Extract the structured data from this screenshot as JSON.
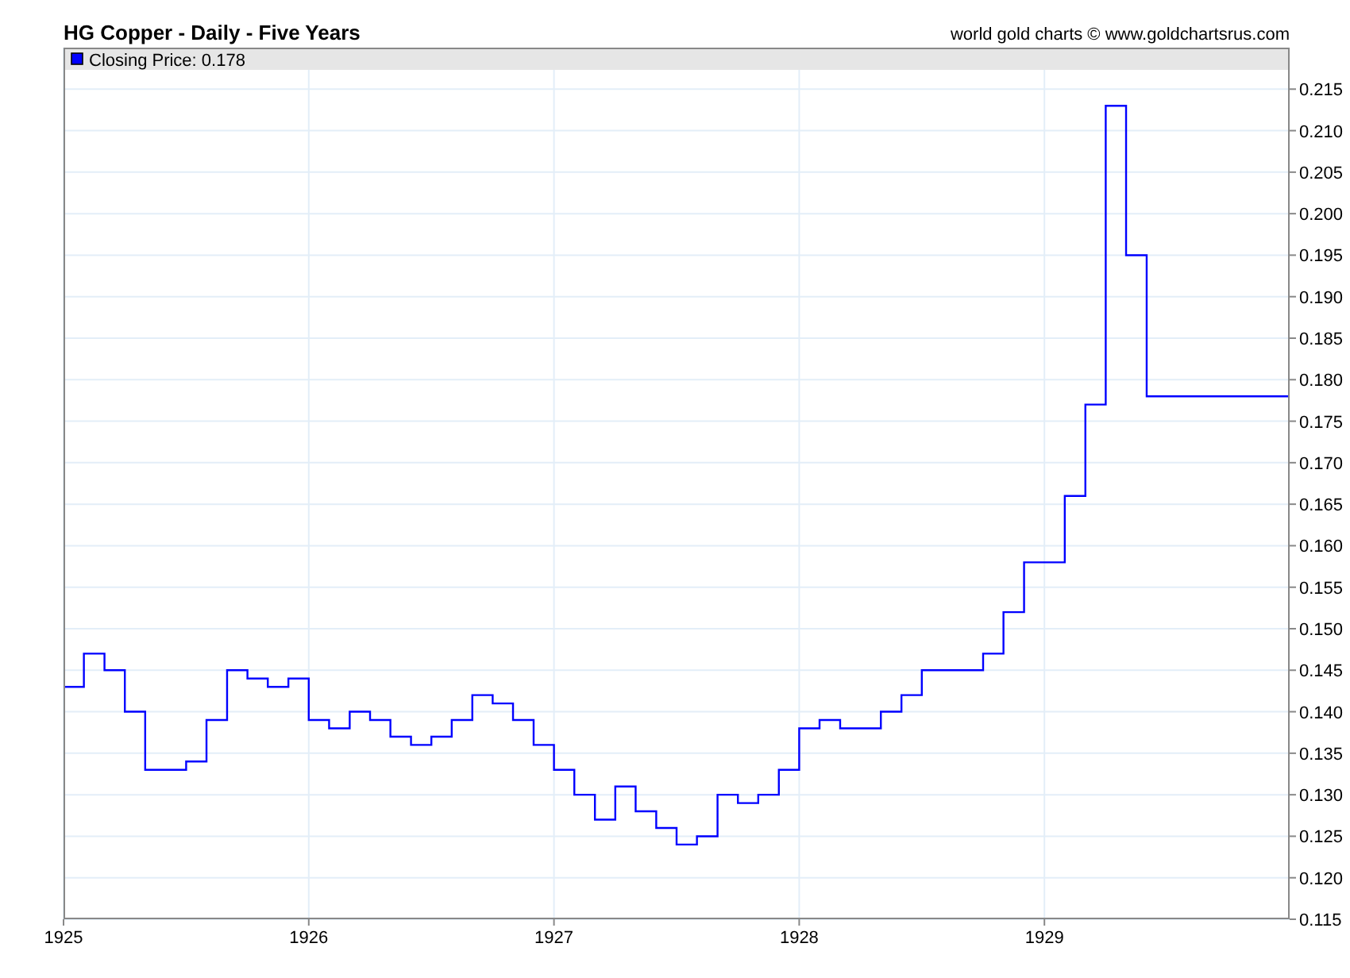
{
  "header": {
    "title": "HG Copper - Daily - Five Years",
    "credit": "world gold charts © www.goldchartsrus.com"
  },
  "chart_data": {
    "type": "line",
    "grid": true,
    "x": [
      1925,
      1925.083,
      1925.083,
      1925.167,
      1925.167,
      1925.25,
      1925.25,
      1925.333,
      1925.333,
      1925.5,
      1925.5,
      1925.583,
      1925.583,
      1925.667,
      1925.667,
      1925.75,
      1925.75,
      1925.833,
      1925.833,
      1925.917,
      1925.917,
      1926,
      1926,
      1926.083,
      1926.083,
      1926.167,
      1926.167,
      1926.25,
      1926.25,
      1926.333,
      1926.333,
      1926.417,
      1926.417,
      1926.5,
      1926.5,
      1926.583,
      1926.583,
      1926.667,
      1926.667,
      1926.75,
      1926.75,
      1926.833,
      1926.833,
      1926.917,
      1926.917,
      1927,
      1927,
      1927.083,
      1927.083,
      1927.167,
      1927.167,
      1927.25,
      1927.25,
      1927.333,
      1927.333,
      1927.417,
      1927.417,
      1927.5,
      1927.5,
      1927.583,
      1927.583,
      1927.667,
      1927.667,
      1927.75,
      1927.75,
      1927.833,
      1927.833,
      1927.917,
      1927.917,
      1928,
      1928,
      1928.083,
      1928.083,
      1928.167,
      1928.167,
      1928.333,
      1928.333,
      1928.417,
      1928.417,
      1928.5,
      1928.5,
      1928.75,
      1928.75,
      1928.833,
      1928.833,
      1928.917,
      1928.917,
      1929.083,
      1929.083,
      1929.167,
      1929.167,
      1929.25,
      1929.25,
      1929.333,
      1929.333,
      1929.417,
      1929.417,
      1930
    ],
    "series": [
      {
        "name": "Closing Price: 0.178",
        "color": "#0000ff",
        "values": [
          0.143,
          0.143,
          0.147,
          0.147,
          0.145,
          0.145,
          0.14,
          0.14,
          0.133,
          0.133,
          0.134,
          0.134,
          0.139,
          0.139,
          0.145,
          0.145,
          0.144,
          0.144,
          0.143,
          0.143,
          0.144,
          0.144,
          0.139,
          0.139,
          0.138,
          0.138,
          0.14,
          0.14,
          0.139,
          0.139,
          0.137,
          0.137,
          0.136,
          0.136,
          0.137,
          0.137,
          0.139,
          0.139,
          0.142,
          0.142,
          0.141,
          0.141,
          0.139,
          0.139,
          0.136,
          0.136,
          0.133,
          0.133,
          0.13,
          0.13,
          0.127,
          0.127,
          0.131,
          0.131,
          0.128,
          0.128,
          0.126,
          0.126,
          0.124,
          0.124,
          0.125,
          0.125,
          0.13,
          0.13,
          0.129,
          0.129,
          0.13,
          0.13,
          0.133,
          0.133,
          0.138,
          0.138,
          0.139,
          0.139,
          0.138,
          0.138,
          0.14,
          0.14,
          0.142,
          0.142,
          0.145,
          0.145,
          0.147,
          0.147,
          0.152,
          0.152,
          0.158,
          0.158,
          0.166,
          0.166,
          0.177,
          0.177,
          0.213,
          0.213,
          0.195,
          0.195,
          0.178,
          0.178
        ]
      }
    ],
    "xlim": [
      1925,
      1930
    ],
    "ylim": [
      0.115,
      0.22
    ],
    "xticks": [
      1925,
      1926,
      1927,
      1928,
      1929
    ],
    "yticks": [
      {
        "value": 0.115,
        "label": "0.115"
      },
      {
        "value": 0.12,
        "label": "0.120"
      },
      {
        "value": 0.125,
        "label": "0.125"
      },
      {
        "value": 0.13,
        "label": "0.130"
      },
      {
        "value": 0.135,
        "label": "0.135"
      },
      {
        "value": 0.14,
        "label": "0.140"
      },
      {
        "value": 0.145,
        "label": "0.145"
      },
      {
        "value": 0.15,
        "label": "0.150"
      },
      {
        "value": 0.155,
        "label": "0.155"
      },
      {
        "value": 0.16,
        "label": "0.160"
      },
      {
        "value": 0.165,
        "label": "0.165"
      },
      {
        "value": 0.17,
        "label": "0.170"
      },
      {
        "value": 0.175,
        "label": "0.175"
      },
      {
        "value": 0.18,
        "label": "0.180"
      },
      {
        "value": 0.185,
        "label": "0.185"
      },
      {
        "value": 0.19,
        "label": "0.190"
      },
      {
        "value": 0.195,
        "label": "0.195"
      },
      {
        "value": 0.2,
        "label": "0.200"
      },
      {
        "value": 0.205,
        "label": "0.205"
      },
      {
        "value": 0.21,
        "label": "0.210"
      },
      {
        "value": 0.215,
        "label": "0.215"
      }
    ]
  }
}
